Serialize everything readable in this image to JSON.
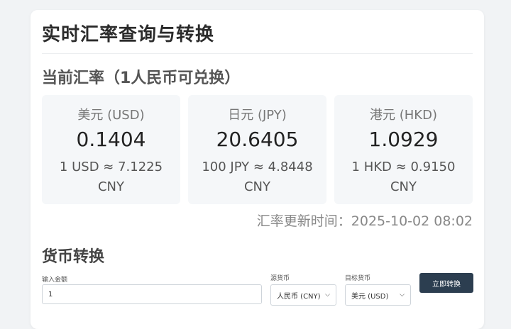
{
  "app": {
    "title": "实时汇率查询与转换"
  },
  "rates_section": {
    "heading": "当前汇率（1人民币可兑换）",
    "cards": [
      {
        "name": "美元 (USD)",
        "value": "0.1404",
        "equivalent": "1 USD ≈ 7.1225 CNY"
      },
      {
        "name": "日元 (JPY)",
        "value": "20.6405",
        "equivalent": "100 JPY ≈ 4.8448 CNY"
      },
      {
        "name": "港元 (HKD)",
        "value": "1.0929",
        "equivalent": "1 HKD ≈ 0.9150 CNY"
      }
    ],
    "update_time": "汇率更新时间：2025-10-02 08:02"
  },
  "converter": {
    "heading": "货币转换",
    "amount_label": "输入金额",
    "amount_value": "1",
    "source_label": "源货币",
    "source_selected": "人民币 (CNY)",
    "target_label": "目标货币",
    "target_selected": "美元 (USD)",
    "convert_button": "立即转换"
  },
  "icons": {
    "select_arrow": "chevron-down-icon"
  }
}
